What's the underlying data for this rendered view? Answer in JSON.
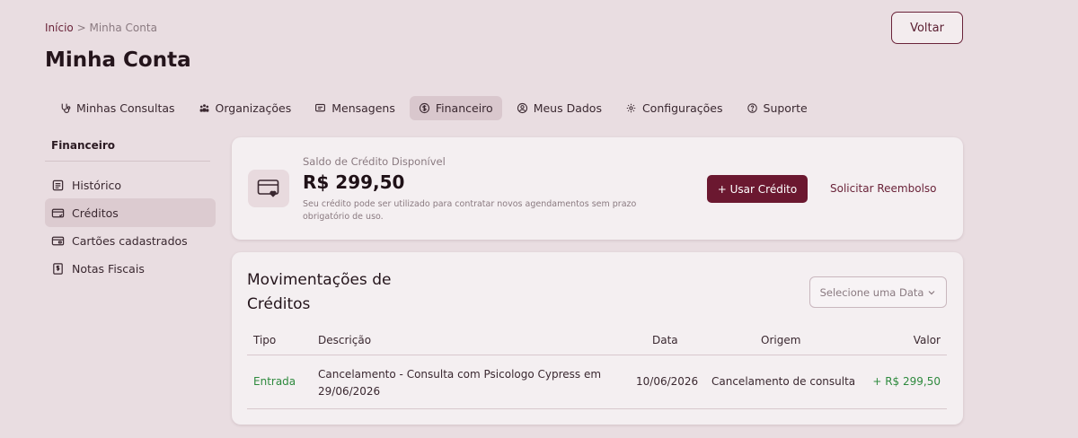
{
  "breadcrumb": {
    "home": "Início",
    "separator": ">",
    "current": "Minha Conta"
  },
  "header": {
    "title": "Minha Conta",
    "back_label": "Voltar"
  },
  "tabs": [
    {
      "label": "Minhas Consultas",
      "icon": "consultations-icon"
    },
    {
      "label": "Organizações",
      "icon": "organizations-icon"
    },
    {
      "label": "Mensagens",
      "icon": "messages-icon"
    },
    {
      "label": "Financeiro",
      "icon": "dollar-icon",
      "active": true
    },
    {
      "label": "Meus Dados",
      "icon": "user-icon"
    },
    {
      "label": "Configurações",
      "icon": "gear-icon"
    },
    {
      "label": "Suporte",
      "icon": "help-icon"
    }
  ],
  "sidebar": {
    "title": "Financeiro",
    "items": [
      {
        "label": "Histórico",
        "icon": "history-icon"
      },
      {
        "label": "Créditos",
        "icon": "credits-icon",
        "active": true
      },
      {
        "label": "Cartões cadastrados",
        "icon": "cards-icon"
      },
      {
        "label": "Notas Fiscais",
        "icon": "invoice-icon"
      }
    ]
  },
  "credit": {
    "label": "Saldo de Crédito Disponível",
    "amount": "R$ 299,50",
    "note": "Seu crédito pode ser utilizado para contratar novos agendamentos sem prazo obrigatório de uso.",
    "use_label": "+ Usar Crédito",
    "refund_label": "Solicitar Reembolso"
  },
  "movements": {
    "title": "Movimentações de Créditos",
    "date_placeholder": "Selecione uma Data",
    "columns": {
      "type": "Tipo",
      "description": "Descrição",
      "date": "Data",
      "origin": "Origem",
      "value": "Valor"
    },
    "rows": [
      {
        "type": "Entrada",
        "description": "Cancelamento - Consulta com Psicologo Cypress em 29/06/2026",
        "date": "10/06/2026",
        "origin": "Cancelamento de consulta",
        "value": "+ R$ 299,50"
      }
    ]
  },
  "colors": {
    "accent": "#6b1830",
    "background": "#e9dde1",
    "positive": "#2e8a3e"
  }
}
